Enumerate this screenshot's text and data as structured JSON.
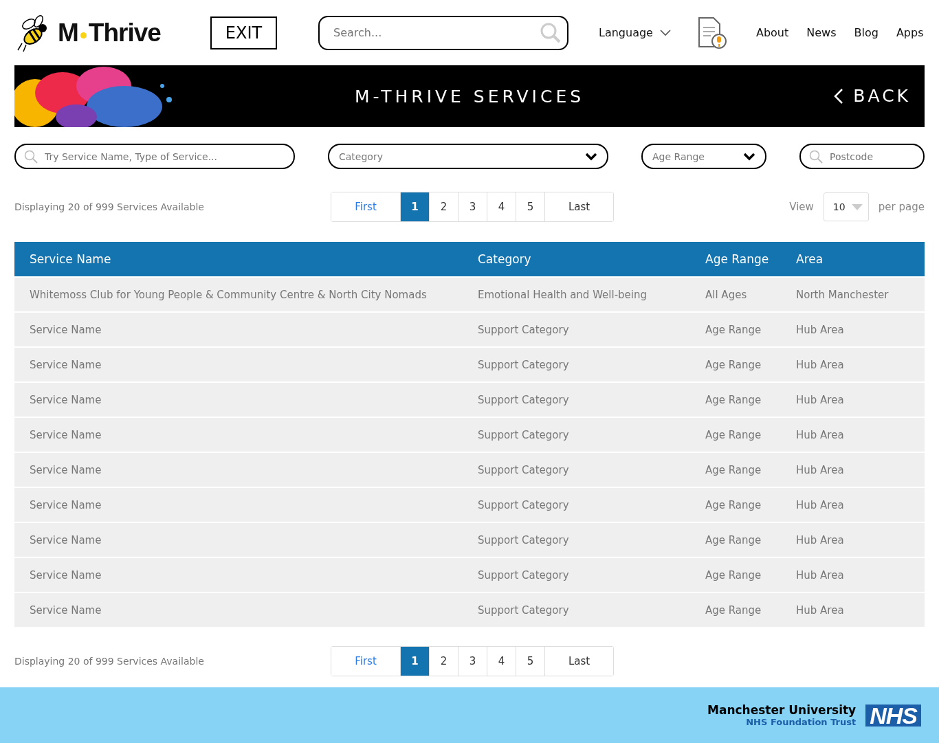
{
  "header": {
    "logo_parts": [
      "M",
      "Thrive"
    ],
    "exit": "EXIT",
    "search": {
      "placeholder": "Search..."
    },
    "language": "Language",
    "nav": [
      "About",
      "News",
      "Blog",
      "Apps"
    ]
  },
  "banner": {
    "title": "M-THRIVE SERVICES",
    "back": "BACK"
  },
  "filters": [
    {
      "kind": "search",
      "placeholder": "Try Service Name, Type of Service..."
    },
    {
      "kind": "select",
      "placeholder": "Category"
    },
    {
      "kind": "select",
      "placeholder": "Age Range"
    },
    {
      "kind": "search",
      "placeholder": "Postcode"
    }
  ],
  "summary": "Displaying 20 of 999 Services Available",
  "pagination": [
    {
      "label": "First",
      "selected": false
    },
    {
      "label": "1",
      "selected": true
    },
    {
      "label": "2",
      "selected": false
    },
    {
      "label": "3",
      "selected": false
    },
    {
      "label": "4",
      "selected": false
    },
    {
      "label": "5",
      "selected": false
    },
    {
      "label": "Last",
      "selected": false
    }
  ],
  "per_page": {
    "view": "View",
    "value": "10",
    "suffix": "per page"
  },
  "table": {
    "columns": [
      "Service Name",
      "Category",
      "Age Range",
      "Area"
    ],
    "rows": [
      [
        "Whitemoss Club for Young People & Community Centre & North City Nomads",
        "Emotional Health and Well-being",
        "All Ages",
        "North Manchester"
      ],
      [
        "Service Name",
        "Support Category",
        "Age Range",
        "Hub Area"
      ],
      [
        "Service Name",
        "Support Category",
        "Age Range",
        "Hub Area"
      ],
      [
        "Service Name",
        "Support Category",
        "Age Range",
        "Hub Area"
      ],
      [
        "Service Name",
        "Support Category",
        "Age Range",
        "Hub Area"
      ],
      [
        "Service Name",
        "Support Category",
        "Age Range",
        "Hub Area"
      ],
      [
        "Service Name",
        "Support Category",
        "Age Range",
        "Hub Area"
      ],
      [
        "Service Name",
        "Support Category",
        "Age Range",
        "Hub Area"
      ],
      [
        "Service Name",
        "Support Category",
        "Age Range",
        "Hub Area"
      ],
      [
        "Service Name",
        "Support Category",
        "Age Range",
        "Hub Area"
      ]
    ]
  },
  "bottom_summary": "Displaying 20 of 999 Services Available",
  "bottom_pagination": [
    {
      "label": "First",
      "selected": false
    },
    {
      "label": "1",
      "selected": true
    },
    {
      "label": "2",
      "selected": false
    },
    {
      "label": "3",
      "selected": false
    },
    {
      "label": "4",
      "selected": false
    },
    {
      "label": "5",
      "selected": false
    },
    {
      "label": "Last",
      "selected": false
    }
  ],
  "footer": {
    "org": "Manchester University",
    "trust": "NHS Foundation Trust",
    "logo": "NHS"
  }
}
